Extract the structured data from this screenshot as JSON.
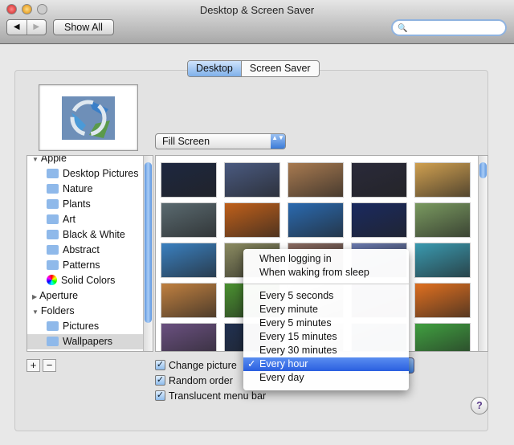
{
  "window": {
    "title": "Desktop & Screen Saver"
  },
  "toolbar": {
    "back": "◀",
    "forward": "▶",
    "show_all": "Show All",
    "search_placeholder": "",
    "search_icon": "🔍"
  },
  "tabs": [
    {
      "label": "Desktop",
      "selected": true
    },
    {
      "label": "Screen Saver",
      "selected": false
    }
  ],
  "fit_popup": {
    "value": "Fill Screen",
    "arrows": "▲▼"
  },
  "sidebar": {
    "items": [
      {
        "label": "Apple",
        "type": "group",
        "disclosure": "▼"
      },
      {
        "label": "Desktop Pictures",
        "type": "folder"
      },
      {
        "label": "Nature",
        "type": "folder"
      },
      {
        "label": "Plants",
        "type": "folder"
      },
      {
        "label": "Art",
        "type": "folder"
      },
      {
        "label": "Black & White",
        "type": "folder"
      },
      {
        "label": "Abstract",
        "type": "folder"
      },
      {
        "label": "Patterns",
        "type": "folder"
      },
      {
        "label": "Solid Colors",
        "type": "colors"
      },
      {
        "label": "Aperture",
        "type": "group",
        "disclosure": "▶"
      },
      {
        "label": "Folders",
        "type": "group",
        "disclosure": "▼"
      },
      {
        "label": "Pictures",
        "type": "folder"
      },
      {
        "label": "Wallpapers",
        "type": "folder",
        "selected": true
      }
    ]
  },
  "list_buttons": {
    "add": "+",
    "remove": "−"
  },
  "thumbnails": [
    [
      "#1d2740",
      "#4a5a80",
      "#a87a50",
      "#2a2a3a",
      "#d0a050"
    ],
    [
      "#5a6a70",
      "#c0601a",
      "#2a6ab0",
      "#1a2a60",
      "#7a9a60"
    ],
    [
      "#3a80c0",
      "#8a8a60",
      "#8a6a60",
      "#6a7ab0",
      "#3a9ab0"
    ],
    [
      "#c08040",
      "#4a9030",
      "#eeeeee",
      "#5a4a7a",
      "#e07020"
    ],
    [
      "#6a5080",
      "#203050",
      "#eeeeee",
      "#406080",
      "#40a040"
    ]
  ],
  "options": {
    "change_picture": {
      "label": "Change picture",
      "checked": true
    },
    "random_order": {
      "label": "Random order",
      "checked": true
    },
    "translucent_menu_bar": {
      "label": "Translucent menu bar",
      "checked": true
    }
  },
  "interval_menu": {
    "group1": [
      "When logging in",
      "When waking from sleep"
    ],
    "group2": [
      "Every 5 seconds",
      "Every minute",
      "Every 5 minutes",
      "Every 15 minutes",
      "Every 30 minutes",
      "Every hour",
      "Every day"
    ],
    "selected": "Every hour",
    "checkmark": "✓"
  },
  "help": "?",
  "colors": {
    "accent": "#2a5fe0"
  }
}
